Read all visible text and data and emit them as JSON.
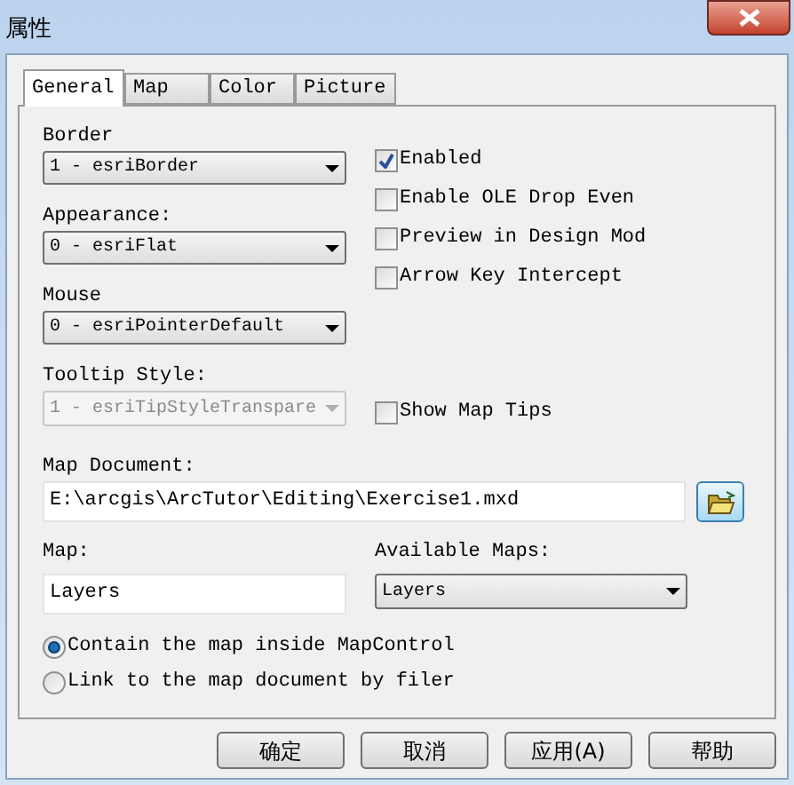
{
  "window": {
    "title": "属性"
  },
  "tabs": [
    {
      "label": "General",
      "selected": true
    },
    {
      "label": "Map",
      "selected": false
    },
    {
      "label": "Color",
      "selected": false
    },
    {
      "label": "Picture",
      "selected": false
    }
  ],
  "dropdowns": [
    {
      "label": "Border",
      "value": "1 - esriBorder",
      "disabled": false
    },
    {
      "label": "Appearance:",
      "value": "0 - esriFlat",
      "disabled": false
    },
    {
      "label": "Mouse",
      "value": "0 - esriPointerDefault",
      "disabled": false
    },
    {
      "label": "Tooltip Style:",
      "value": "1 - esriTipStyleTranspare",
      "disabled": true
    }
  ],
  "checkboxes": [
    {
      "label": "Enabled",
      "checked": true
    },
    {
      "label": "Enable OLE Drop Even",
      "checked": false
    },
    {
      "label": "Preview in Design Mod",
      "checked": false
    },
    {
      "label": "Arrow Key Intercept",
      "checked": false
    }
  ],
  "show_map_tips": {
    "label": "Show Map Tips",
    "checked": false
  },
  "map_document": {
    "label": "Map Document:",
    "value": "E:\\arcgis\\ArcTutor\\Editing\\Exercise1.mxd"
  },
  "map": {
    "label": "Map:",
    "value": "Layers"
  },
  "available_maps": {
    "label": "Available Maps:",
    "value": "Layers"
  },
  "radios": [
    {
      "label": "Contain the map inside MapControl",
      "selected": true
    },
    {
      "label": "Link to the map document by filer",
      "selected": false
    }
  ],
  "buttons": [
    "确定",
    "取消",
    "应用(A)",
    "帮助"
  ]
}
